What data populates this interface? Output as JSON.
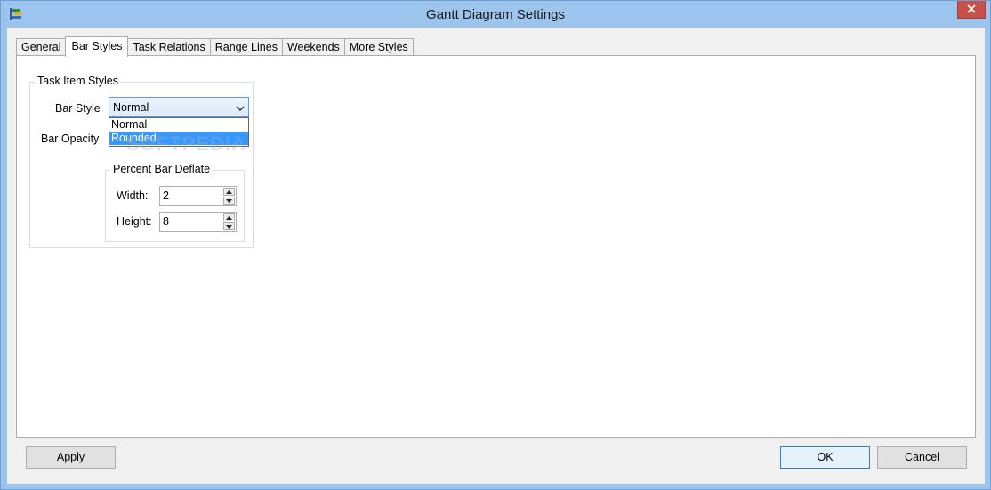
{
  "window": {
    "title": "Gantt Diagram Settings",
    "accent_color": "#9cc4ed",
    "close_color": "#c7504a",
    "app_icon": "gantt-app-icon",
    "close_icon": "close-x-icon"
  },
  "tabs": [
    {
      "label": "General",
      "active": false
    },
    {
      "label": "Bar Styles",
      "active": true
    },
    {
      "label": "Task Relations",
      "active": false
    },
    {
      "label": "Range Lines",
      "active": false
    },
    {
      "label": "Weekends",
      "active": false
    },
    {
      "label": "More Styles",
      "active": false
    }
  ],
  "task_item_styles": {
    "legend": "Task Item Styles",
    "bar_style_label": "Bar Style",
    "bar_style_value": "Normal",
    "bar_style_options": [
      {
        "label": "Normal",
        "highlighted": false
      },
      {
        "label": "Rounded",
        "highlighted": true
      }
    ],
    "bar_opacity_label": "Bar Opacity",
    "percent_bar_deflate": {
      "legend": "Percent Bar Deflate",
      "width_label": "Width:",
      "width_value": "2",
      "height_label": "Height:",
      "height_value": "8"
    }
  },
  "watermark": "SOFTPEDIA",
  "buttons": {
    "apply": "Apply",
    "ok": "OK",
    "cancel": "Cancel"
  }
}
